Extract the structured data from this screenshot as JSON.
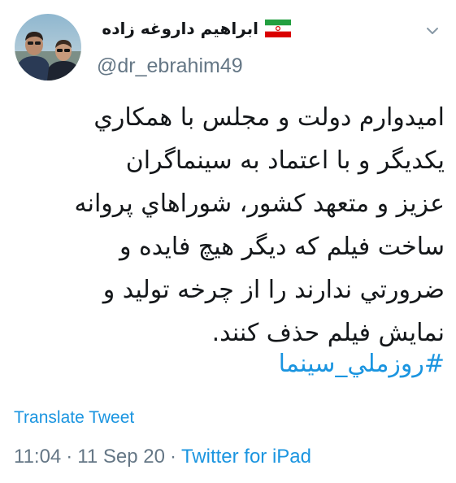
{
  "tweet": {
    "author": {
      "display_name": "ابراهیم داروغه زاده",
      "handle": "@dr_ebrahim49",
      "flag_icon": "iran-flag-icon",
      "avatar_icon": "profile-photo"
    },
    "text_lines": [
      "امیدوارم دولت و مجلس با همکاري",
      "یکدیگر و با اعتماد به سینماگران",
      "عزیز و متعهد کشور، شوراهاي پروانه",
      "ساخت فیلم که دیگر هیچ فایده و",
      "ضرورتي ندارند را از چرخه تولید و",
      "نمایش فیلم حذف کنند."
    ],
    "hashtag": "#روزملي_سینما",
    "translate_label": "Translate Tweet",
    "time": "11:04",
    "date": "11 Sep 20",
    "separator": "·",
    "source": "Twitter for iPad"
  },
  "colors": {
    "text": "#14171a",
    "secondary": "#657786",
    "link": "#1b95e0",
    "background": "#ffffff"
  }
}
